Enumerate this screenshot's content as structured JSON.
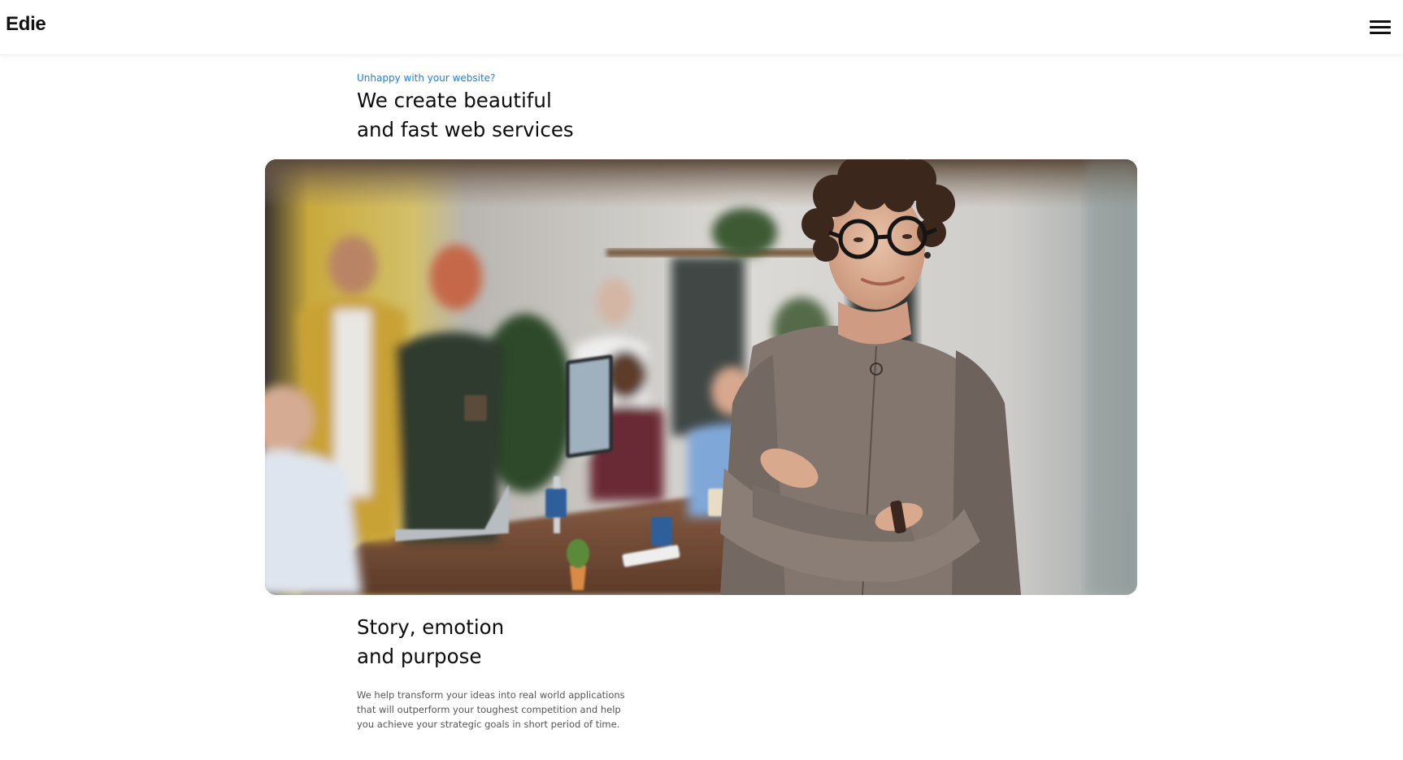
{
  "header": {
    "brand": "Edie",
    "menu_icon": "hamburger-menu-icon"
  },
  "hero": {
    "eyebrow": "Unhappy with your website?",
    "title_lines": [
      "We create beautiful",
      "and fast web services"
    ]
  },
  "story": {
    "title_lines": [
      "Story, emotion",
      "and purpose"
    ],
    "body_lines": [
      "We help transform your ideas into real world applications",
      "that will outperform your toughest competition and help",
      "you achieve your strategic goals in short period of time."
    ]
  },
  "colors": {
    "accent": "#1f7fd6",
    "text": "#0d0d0d",
    "muted": "#555555",
    "background": "#ffffff"
  }
}
